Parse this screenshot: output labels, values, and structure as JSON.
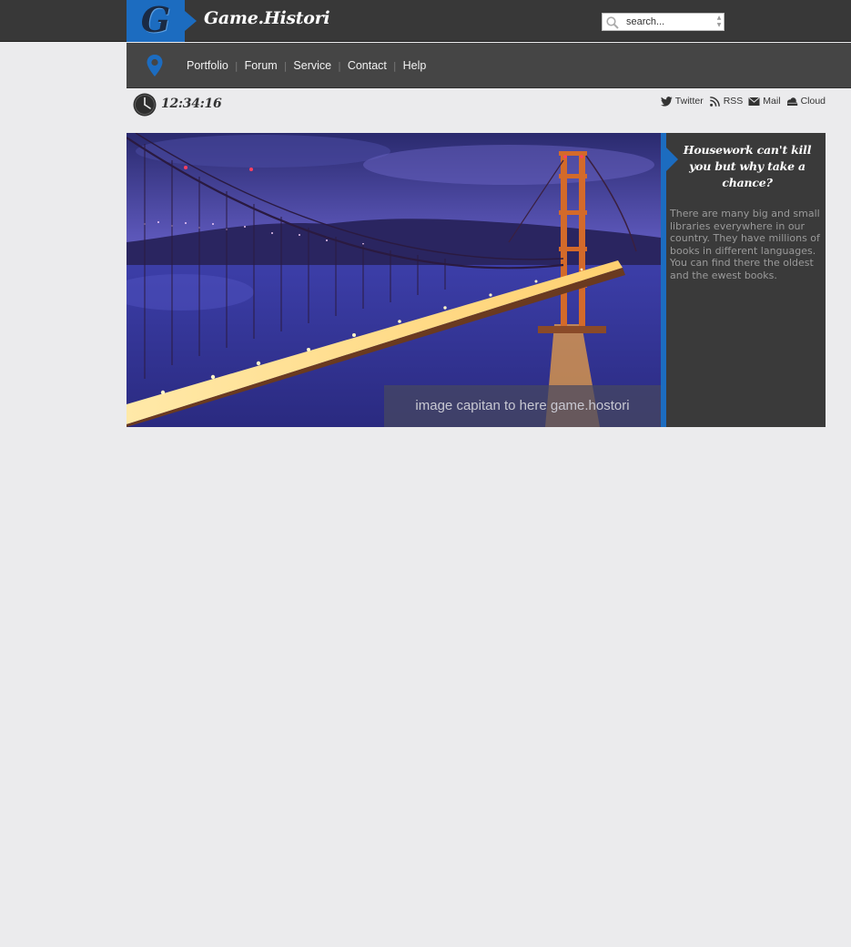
{
  "header": {
    "logo_letter": "G",
    "site_title": "Game.Histori",
    "search": {
      "placeholder": "search..."
    }
  },
  "nav": {
    "items": [
      "Portfolio",
      "Forum",
      "Service",
      "Contact",
      "Help"
    ]
  },
  "info_bar": {
    "clock_time": "12:34:16",
    "social": [
      {
        "label": "Twitter",
        "icon": "twitter-icon"
      },
      {
        "label": "RSS",
        "icon": "rss-icon"
      },
      {
        "label": "Mail",
        "icon": "mail-icon"
      },
      {
        "label": "Cloud",
        "icon": "cloud-icon"
      }
    ]
  },
  "hero": {
    "caption": "image capitan to here game.hostori"
  },
  "sidebar": {
    "heading": "Housework can't kill you but why take a chance?",
    "body": "There are many big and small libraries everywhere in our country. They have millions of books in different languages. You can find there the oldest and the ewest books."
  },
  "colors": {
    "accent": "#1c6cc0",
    "topbar": "#383838",
    "navbar": "#454545",
    "page_bg": "#ebebed",
    "side_panel": "#3a3a3a"
  }
}
